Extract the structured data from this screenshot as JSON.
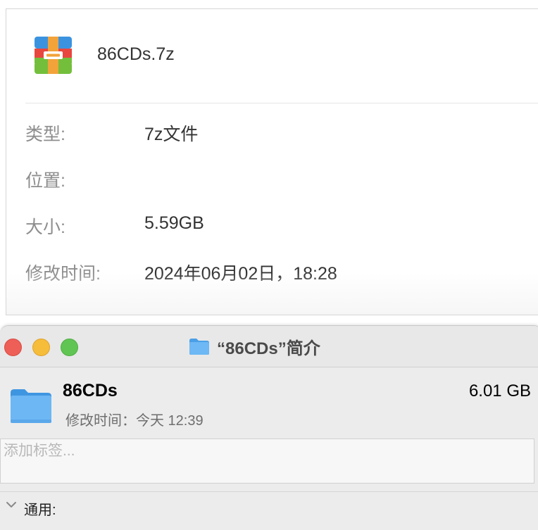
{
  "file_info": {
    "icon": "7z-archive-icon",
    "name": "86CDs.7z",
    "properties": [
      {
        "label": "类型:",
        "value": "7z文件"
      },
      {
        "label": "位置:",
        "value": ""
      },
      {
        "label": "大小:",
        "value": "5.59GB"
      },
      {
        "label": "修改时间:",
        "value": "2024年06月02日，18:28"
      }
    ]
  },
  "info_window": {
    "title": "“86CDs”简介",
    "title_icon": "folder-icon",
    "traffic_lights": {
      "close": "#ee5f57",
      "minimize": "#f6bd3a",
      "zoom": "#61c554"
    },
    "item": {
      "icon": "folder-icon",
      "name": "86CDs",
      "size": "6.01 GB",
      "modified": "修改时间：今天 12:39"
    },
    "tags": {
      "value": "",
      "placeholder": "添加标签..."
    },
    "section": {
      "icon": "chevron-down-icon",
      "label": "通用:"
    }
  },
  "colors": {
    "folder_blue": "#69b4f2",
    "accent_gray": "#8d8d8d"
  }
}
